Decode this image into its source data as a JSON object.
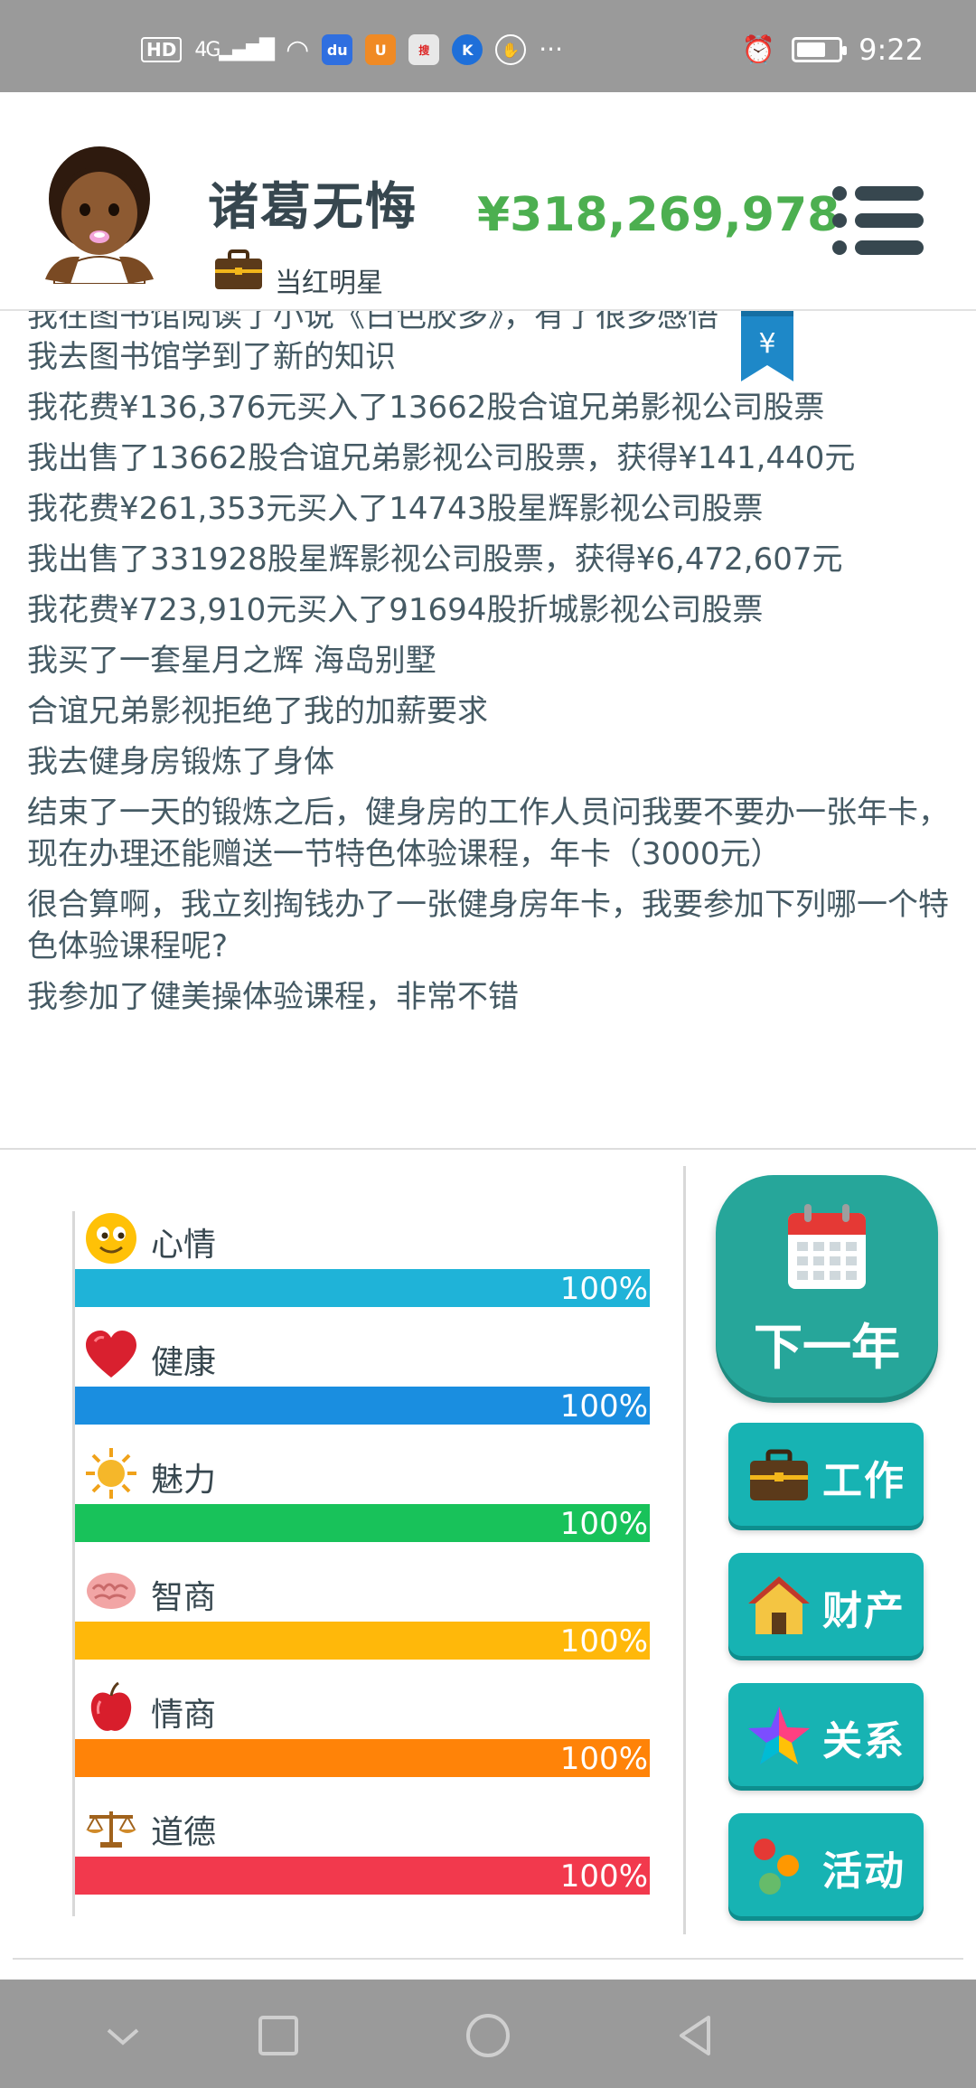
{
  "status_bar": {
    "hd": "HD",
    "network": "4G",
    "app_icons": [
      "baidu-app-icon",
      "uc-app-icon",
      "sohu-video-app-icon",
      "kuwo-app-icon",
      "shield-app-icon"
    ],
    "more": "···",
    "time": "9:22"
  },
  "header": {
    "name": "诸葛无悔",
    "job_title": "当红明星",
    "money": "¥318,269,978"
  },
  "log": {
    "partial_top": "我在图书馆阅读了小说《白色胶多》，有了很多感悟",
    "entries": [
      "我去图书馆学到了新的知识",
      "我花费¥136,376元买入了13662股合谊兄弟影视公司股票",
      "我出售了13662股合谊兄弟影视公司股票，获得¥141,440元",
      "我花费¥261,353元买入了14743股星辉影视公司股票",
      "我出售了331928股星辉影视公司股票，获得¥6,472,607元",
      "我花费¥723,910元买入了91694股折城影视公司股票",
      "我买了一套星月之辉 海岛别墅",
      "合谊兄弟影视拒绝了我的加薪要求",
      "我去健身房锻炼了身体",
      "结束了一天的锻炼之后，健身房的工作人员问我要不要办一张年卡，现在办理还能赠送一节特色体验课程，年卡（3000元）",
      "很合算啊，我立刻掏钱办了一张健身房年卡，我要参加下列哪一个特色体验课程呢?",
      "我参加了健美操体验课程，非常不错"
    ],
    "bookmark_symbol": "¥"
  },
  "stats": [
    {
      "label": "心情",
      "value": "100%",
      "fraction": 1.0,
      "color": "#1fb3d8",
      "icon": "smiley-icon"
    },
    {
      "label": "健康",
      "value": "100%",
      "fraction": 1.0,
      "color": "#1a8ee0",
      "icon": "heart-icon"
    },
    {
      "label": "魅力",
      "value": "100%",
      "fraction": 1.0,
      "color": "#18c25a",
      "icon": "sun-icon"
    },
    {
      "label": "智商",
      "value": "100%",
      "fraction": 1.0,
      "color": "#ffb80a",
      "icon": "brain-icon"
    },
    {
      "label": "情商",
      "value": "100%",
      "fraction": 1.0,
      "color": "#ff8308",
      "icon": "apple-icon"
    },
    {
      "label": "道德",
      "value": "100%",
      "fraction": 1.0,
      "color": "#f2394d",
      "icon": "scales-icon"
    }
  ],
  "buttons": {
    "next_year": "下一年",
    "work": "工作",
    "property": "财产",
    "relations": "关系",
    "activities": "活动"
  },
  "colors": {
    "money": "#4caf50",
    "button_teal": "#17b3b3",
    "next_year_green": "#26a69a",
    "text": "#455a64"
  }
}
